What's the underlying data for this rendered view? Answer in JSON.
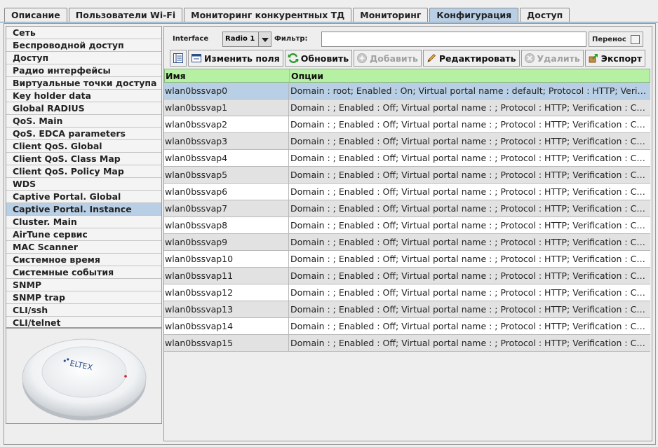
{
  "tabs": [
    "Описание",
    "Пользователи Wi-Fi",
    "Мониторинг конкурентных ТД",
    "Мониторинг",
    "Конфигурация",
    "Доступ"
  ],
  "active_tab": 4,
  "nav": {
    "items": [
      "Сеть",
      "Беспроводной доступ",
      "Доступ",
      "Радио интерфейсы",
      "Виртуальные точки доступа",
      "Key holder data",
      "Global RADIUS",
      "QoS. Main",
      "QoS. EDCA parameters",
      "Client QoS. Global",
      "Client QoS. Class Map",
      "Client QoS. Policy Map",
      "WDS",
      "Captive Portal. Global",
      "Captive Portal. Instance",
      "Cluster. Main",
      "AirTune сервис",
      "MAC Scanner",
      "Системное время",
      "Системные события",
      "SNMP",
      "SNMP trap",
      "CLI/ssh",
      "CLI/telnet"
    ],
    "selected": 14
  },
  "device": {
    "brand": "ELTEX",
    "led_color": "#cc2222"
  },
  "filterbar": {
    "interface_label": "Interface",
    "interface_value": "Radio 1",
    "filter_label": "Фильтр:",
    "filter_value": "",
    "wrap_label": "Перенос"
  },
  "toolbar": {
    "columns_icon": "columns-icon",
    "edit_fields": "Изменить поля",
    "refresh": "Обновить",
    "add": "Добавить",
    "edit": "Редактировать",
    "delete": "Удалить",
    "export": "Экспорт"
  },
  "table": {
    "headers": [
      "Имя",
      "Опции"
    ],
    "selected_row": 0,
    "rows": [
      [
        "wlan0bssvap0",
        "Domain : root; Enabled : On; Virtual portal name : default; Protocol : HTTP; Verifi..."
      ],
      [
        "wlan0bssvap1",
        "Domain : ; Enabled : Off; Virtual portal name : ; Protocol : HTTP; Verification : Ca..."
      ],
      [
        "wlan0bssvap2",
        "Domain : ; Enabled : Off; Virtual portal name : ; Protocol : HTTP; Verification : Ca..."
      ],
      [
        "wlan0bssvap3",
        "Domain : ; Enabled : Off; Virtual portal name : ; Protocol : HTTP; Verification : Ca..."
      ],
      [
        "wlan0bssvap4",
        "Domain : ; Enabled : Off; Virtual portal name : ; Protocol : HTTP; Verification : Ca..."
      ],
      [
        "wlan0bssvap5",
        "Domain : ; Enabled : Off; Virtual portal name : ; Protocol : HTTP; Verification : Ca..."
      ],
      [
        "wlan0bssvap6",
        "Domain : ; Enabled : Off; Virtual portal name : ; Protocol : HTTP; Verification : Ca..."
      ],
      [
        "wlan0bssvap7",
        "Domain : ; Enabled : Off; Virtual portal name : ; Protocol : HTTP; Verification : Ca..."
      ],
      [
        "wlan0bssvap8",
        "Domain : ; Enabled : Off; Virtual portal name : ; Protocol : HTTP; Verification : Ca..."
      ],
      [
        "wlan0bssvap9",
        "Domain : ; Enabled : Off; Virtual portal name : ; Protocol : HTTP; Verification : Ca..."
      ],
      [
        "wlan0bssvap10",
        "Domain : ; Enabled : Off; Virtual portal name : ; Protocol : HTTP; Verification : Ca..."
      ],
      [
        "wlan0bssvap11",
        "Domain : ; Enabled : Off; Virtual portal name : ; Protocol : HTTP; Verification : Ca..."
      ],
      [
        "wlan0bssvap12",
        "Domain : ; Enabled : Off; Virtual portal name : ; Protocol : HTTP; Verification : Ca..."
      ],
      [
        "wlan0bssvap13",
        "Domain : ; Enabled : Off; Virtual portal name : ; Protocol : HTTP; Verification : Ca..."
      ],
      [
        "wlan0bssvap14",
        "Domain : ; Enabled : Off; Virtual portal name : ; Protocol : HTTP; Verification : Ca..."
      ],
      [
        "wlan0bssvap15",
        "Domain : ; Enabled : Off; Virtual portal name : ; Protocol : HTTP; Verification : Ca..."
      ]
    ]
  }
}
